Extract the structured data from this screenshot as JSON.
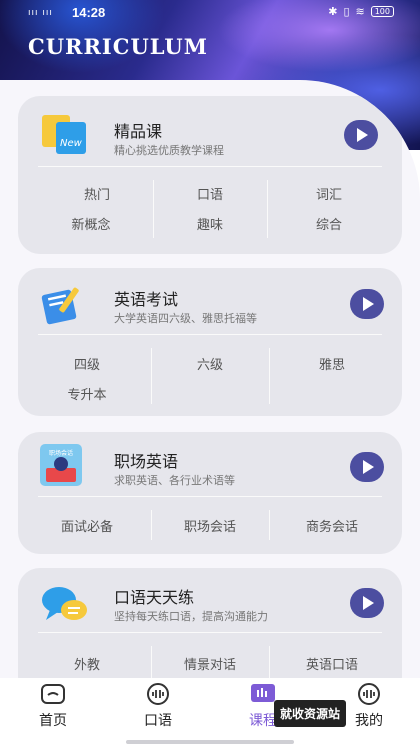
{
  "status_bar": {
    "time": "14:28",
    "signal": "ııı ııı",
    "icons": [
      "bluetooth-icon",
      "vibrate-icon",
      "wifi-icon"
    ],
    "battery": "100"
  },
  "app": {
    "title": "CURRICULUM"
  },
  "cards": [
    {
      "title": "精品课",
      "subtitle": "精心挑选优质教学课程",
      "icon": "new-badge-icon",
      "tags": [
        "热门",
        "口语",
        "词汇",
        "新概念",
        "趣味",
        "综合"
      ]
    },
    {
      "title": "英语考试",
      "subtitle": "大学英语四六级、雅思托福等",
      "icon": "exam-pen-icon",
      "tags": [
        "四级",
        "六级",
        "雅思",
        "专升本"
      ]
    },
    {
      "title": "职场英语",
      "subtitle": "求职英语、各行业术语等",
      "icon": "workplace-icon",
      "icon_text": "职场会话",
      "tags": [
        "面试必备",
        "职场会话",
        "商务会话"
      ]
    },
    {
      "title": "口语天天练",
      "subtitle": "坚持每天练口语，提高沟通能力",
      "icon": "speech-bubbles-icon",
      "tags": [
        "外教",
        "情景对话",
        "英语口语"
      ]
    }
  ],
  "tabbar": [
    {
      "label": "首页",
      "icon": "home-icon"
    },
    {
      "label": "口语",
      "icon": "voice-icon"
    },
    {
      "label": "课程",
      "icon": "course-icon",
      "active": true
    },
    {
      "label": "我的",
      "icon": "profile-icon"
    }
  ],
  "toast": {
    "text": "就收资源站"
  },
  "colors": {
    "accent": "#7d5bd6",
    "play_button": "#4c4ea0",
    "card_bg": "#e6e6ec"
  }
}
